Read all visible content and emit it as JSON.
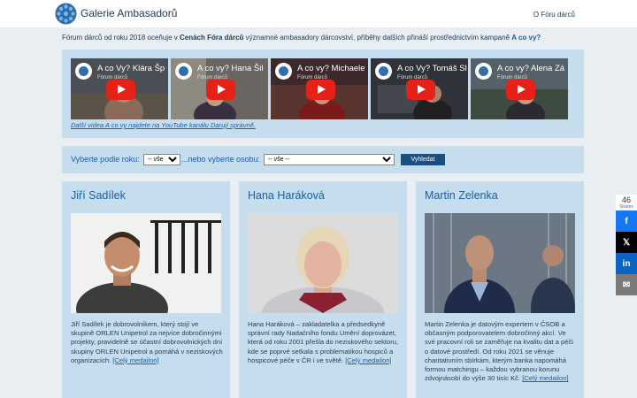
{
  "header": {
    "brand": "Galerie Ambasadorů",
    "about_link": "O Fóru dárců"
  },
  "intro": {
    "text_1": "Fórum dárců od roku 2018 oceňuje v ",
    "bold": "Cenách Fóra dárců",
    "text_2": " významné ambasadory dárcovství, příběhy dalších přináší prostřednictvím kampaně ",
    "link": "A co vy?"
  },
  "videos": {
    "items": [
      {
        "title": "A co Vy? Klára Šp",
        "channel": "Fórum dárců"
      },
      {
        "title": "A co vy? Hana Šil",
        "channel": "Fórum dárců"
      },
      {
        "title": "A co vy? Michaele",
        "channel": "Fórum dárců"
      },
      {
        "title": "A co Vy? Tomáš Sl",
        "channel": "Fórum dárců"
      },
      {
        "title": "A co vy? Alena Zá",
        "channel": "Fórum dárců"
      }
    ],
    "more_link": "Další videa A co vy najdete na YouTube kanálu Darují správně."
  },
  "filter": {
    "year_label": "Vyberte podle roku:",
    "year_value": "-- vše --",
    "person_label": "...nebo vyberte osobu:",
    "person_value": "-- vše --",
    "search_button": "Vyhledat"
  },
  "ambassadors": [
    {
      "name": "Jiří Sadílek",
      "bio": "Jiří Sadílek je dobrovolníkem, který stojí ve skupině ORLEN Unipetrol za nejvíce dobročinnými projekty, pravidelně se účastní dobrovolnických dní skupiny ORLEN Unipetrol a pomáhá v neziskových organizacích.",
      "link": "[Celý medailon]"
    },
    {
      "name": "Hana Haráková",
      "bio": "Hana Haráková – zakladatelka a předsedkyně správní rady Nadačního fondu Umění doprovázet, která od roku 2001 přešla do neziskového sektoru, kde se poprvé setkala s problematikou hospiců a hospicové péče v ČR i ve světě.",
      "link": "[Celý medailon]"
    },
    {
      "name": "Martin Zelenka",
      "bio": "Martin Zelenka je datovým expertem v ČSOB a občasným podporovatelem dobročinný akcí. Ve své pracovní roli se zaměřuje na kvalitu dat a péči o datové prostředí. Od roku 2021 se věnuje charitativním sbírkám, kterým banka napomáhá formou matchingu – každou vybranou korunu zdvojnásobí do výše 30 tisíc Kč.",
      "link": "[Celý medailon]"
    }
  ],
  "share": {
    "count": "46",
    "label": "Shares",
    "facebook": "f",
    "x": "𝕏",
    "linkedin": "in",
    "mail": "✉"
  }
}
